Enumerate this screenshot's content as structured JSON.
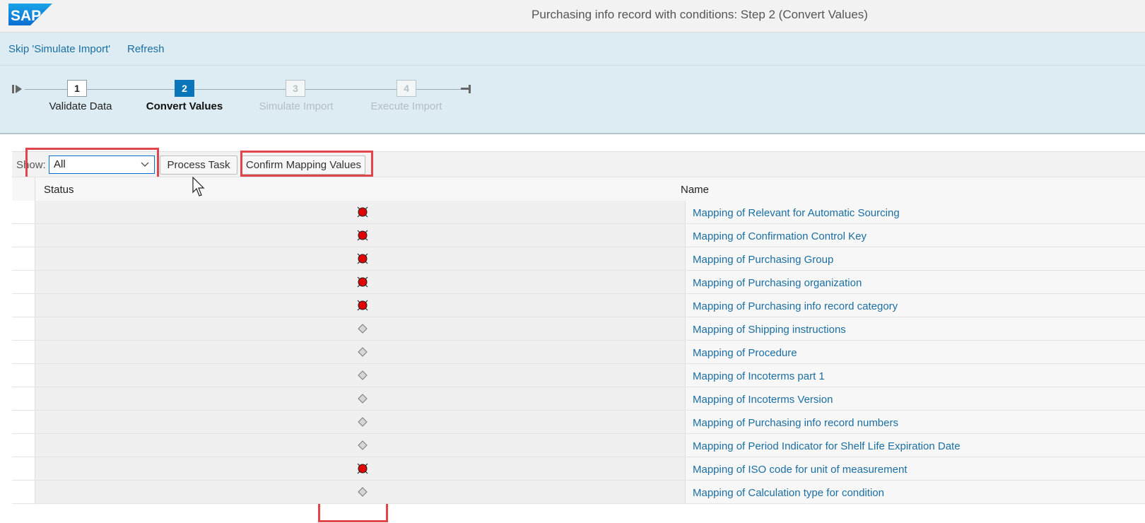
{
  "shell": {
    "logo_text": "SAP",
    "title": "Purchasing info record with conditions: Step 2  (Convert Values)"
  },
  "toolbar": {
    "skip_label": "Skip 'Simulate Import'",
    "refresh_label": "Refresh"
  },
  "roadmap": {
    "steps": [
      {
        "number": "1",
        "label": "Validate Data",
        "state": "done"
      },
      {
        "number": "2",
        "label": "Convert Values",
        "state": "active"
      },
      {
        "number": "3",
        "label": "Simulate Import",
        "state": "future"
      },
      {
        "number": "4",
        "label": "Execute Import",
        "state": "future"
      }
    ]
  },
  "filter": {
    "show_label": "Show:",
    "show_value": "All",
    "process_task_label": "Process Task",
    "confirm_label": "Confirm Mapping Values"
  },
  "table": {
    "columns": {
      "status": "Status",
      "name": "Name"
    },
    "rows": [
      {
        "status": "error",
        "name": "Mapping of Relevant for Automatic Sourcing"
      },
      {
        "status": "error",
        "name": "Mapping of Confirmation Control Key"
      },
      {
        "status": "error",
        "name": "Mapping of Purchasing Group"
      },
      {
        "status": "error",
        "name": "Mapping of Purchasing organization"
      },
      {
        "status": "error",
        "name": "Mapping of Purchasing info record category"
      },
      {
        "status": "inactive",
        "name": "Mapping of Shipping instructions"
      },
      {
        "status": "inactive",
        "name": "Mapping of Procedure"
      },
      {
        "status": "inactive",
        "name": "Mapping of Incoterms part 1"
      },
      {
        "status": "inactive",
        "name": "Mapping of Incoterms Version"
      },
      {
        "status": "inactive",
        "name": "Mapping of Purchasing info record numbers"
      },
      {
        "status": "inactive",
        "name": "Mapping of Period Indicator for Shelf Life Expiration Date"
      },
      {
        "status": "error",
        "name": "Mapping of ISO code for unit of measurement"
      },
      {
        "status": "inactive",
        "name": "Mapping of Calculation type for condition"
      }
    ]
  },
  "colors": {
    "accent": "#0a75b8",
    "link": "#1a6ea2",
    "highlight": "#e0454b",
    "error": "#e00000"
  }
}
